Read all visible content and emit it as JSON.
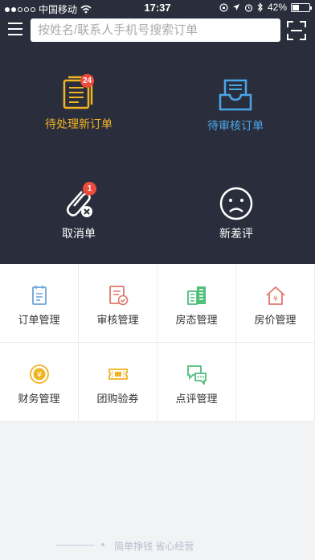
{
  "status_bar": {
    "carrier": "中国移动",
    "time": "17:37",
    "battery": "42%",
    "battery_level": 0.42,
    "icons": [
      "signal-dots",
      "wifi-icon",
      "rotation-lock-icon",
      "location-icon",
      "alarm-icon",
      "bluetooth-icon",
      "battery-icon"
    ]
  },
  "header": {
    "menu_icon": "hamburger-icon",
    "search_placeholder": "按姓名/联系人手机号搜索订单",
    "scan_icon": "scan-icon"
  },
  "dashboard": {
    "pending_new_orders": {
      "label": "待处理新订单",
      "badge": "24",
      "color": "#f0b322",
      "icon": "document-icon"
    },
    "pending_review_orders": {
      "label": "待审核订单",
      "color": "#4aa5e6",
      "icon": "inbox-icon"
    },
    "cancelled_orders": {
      "label": "取消单",
      "badge": "1",
      "color": "#ffffff",
      "icon": "paperclip-cancel-icon"
    },
    "new_negative_reviews": {
      "label": "新差评",
      "color": "#ffffff",
      "icon": "sad-face-icon"
    }
  },
  "modules": [
    {
      "label": "订单管理",
      "icon": "order-list-icon",
      "color": "#6aa4d8"
    },
    {
      "label": "审核管理",
      "icon": "review-check-icon",
      "color": "#e0776b"
    },
    {
      "label": "房态管理",
      "icon": "building-icon",
      "color": "#4fbf7a"
    },
    {
      "label": "房价管理",
      "icon": "house-price-icon",
      "color": "#e0776b"
    },
    {
      "label": "财务管理",
      "icon": "coin-icon",
      "color": "#f0b322"
    },
    {
      "label": "团购验券",
      "icon": "coupon-icon",
      "color": "#f0b322"
    },
    {
      "label": "点评管理",
      "icon": "comment-icon",
      "color": "#4fbf7a"
    }
  ],
  "footer": {
    "slogan": "简单挣钱 省心经营"
  },
  "colors": {
    "dark_background": "#2a2e3c",
    "badge": "#ef4b3b",
    "page_background": "#f2f3f5"
  }
}
